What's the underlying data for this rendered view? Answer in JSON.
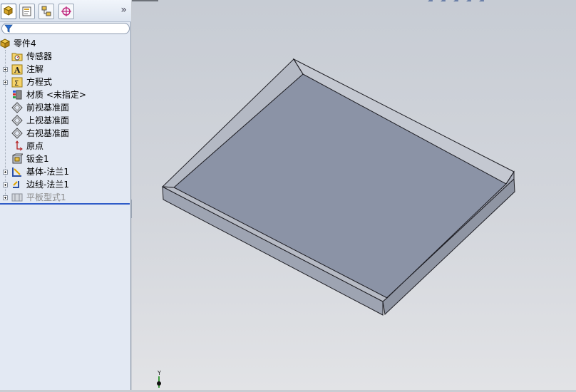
{
  "filter": {
    "placeholder": ""
  },
  "panel": {
    "collapse": "»",
    "tree": [
      {
        "label": "零件4",
        "icon": "part-icon",
        "expandable": false
      },
      {
        "label": "传感器",
        "icon": "sensor-folder-icon",
        "expandable": false
      },
      {
        "label": "注解",
        "icon": "annotations-icon",
        "expandable": true
      },
      {
        "label": "方程式",
        "icon": "equations-folder-icon",
        "expandable": true
      },
      {
        "label": "材质 <未指定>",
        "icon": "material-icon",
        "expandable": false
      },
      {
        "label": "前视基准面",
        "icon": "plane-icon",
        "expandable": false
      },
      {
        "label": "上视基准面",
        "icon": "plane-icon",
        "expandable": false
      },
      {
        "label": "右视基准面",
        "icon": "plane-icon",
        "expandable": false
      },
      {
        "label": "原点",
        "icon": "origin-icon",
        "expandable": false
      },
      {
        "label": "钣金1",
        "icon": "sheet-metal-icon",
        "expandable": false
      },
      {
        "label": "基体-法兰1",
        "icon": "base-flange-icon",
        "expandable": true
      },
      {
        "label": "边线-法兰1",
        "icon": "edge-flange-icon",
        "expandable": true
      },
      {
        "label": "平板型式1",
        "icon": "flat-pattern-icon",
        "expandable": true,
        "suppressed": true
      }
    ]
  },
  "viewport": {
    "triad_label": "Y"
  },
  "colors": {
    "part_face": "#8b93a6",
    "panel_bg": "#e3e9f3",
    "rollback": "#2f5cc8"
  }
}
